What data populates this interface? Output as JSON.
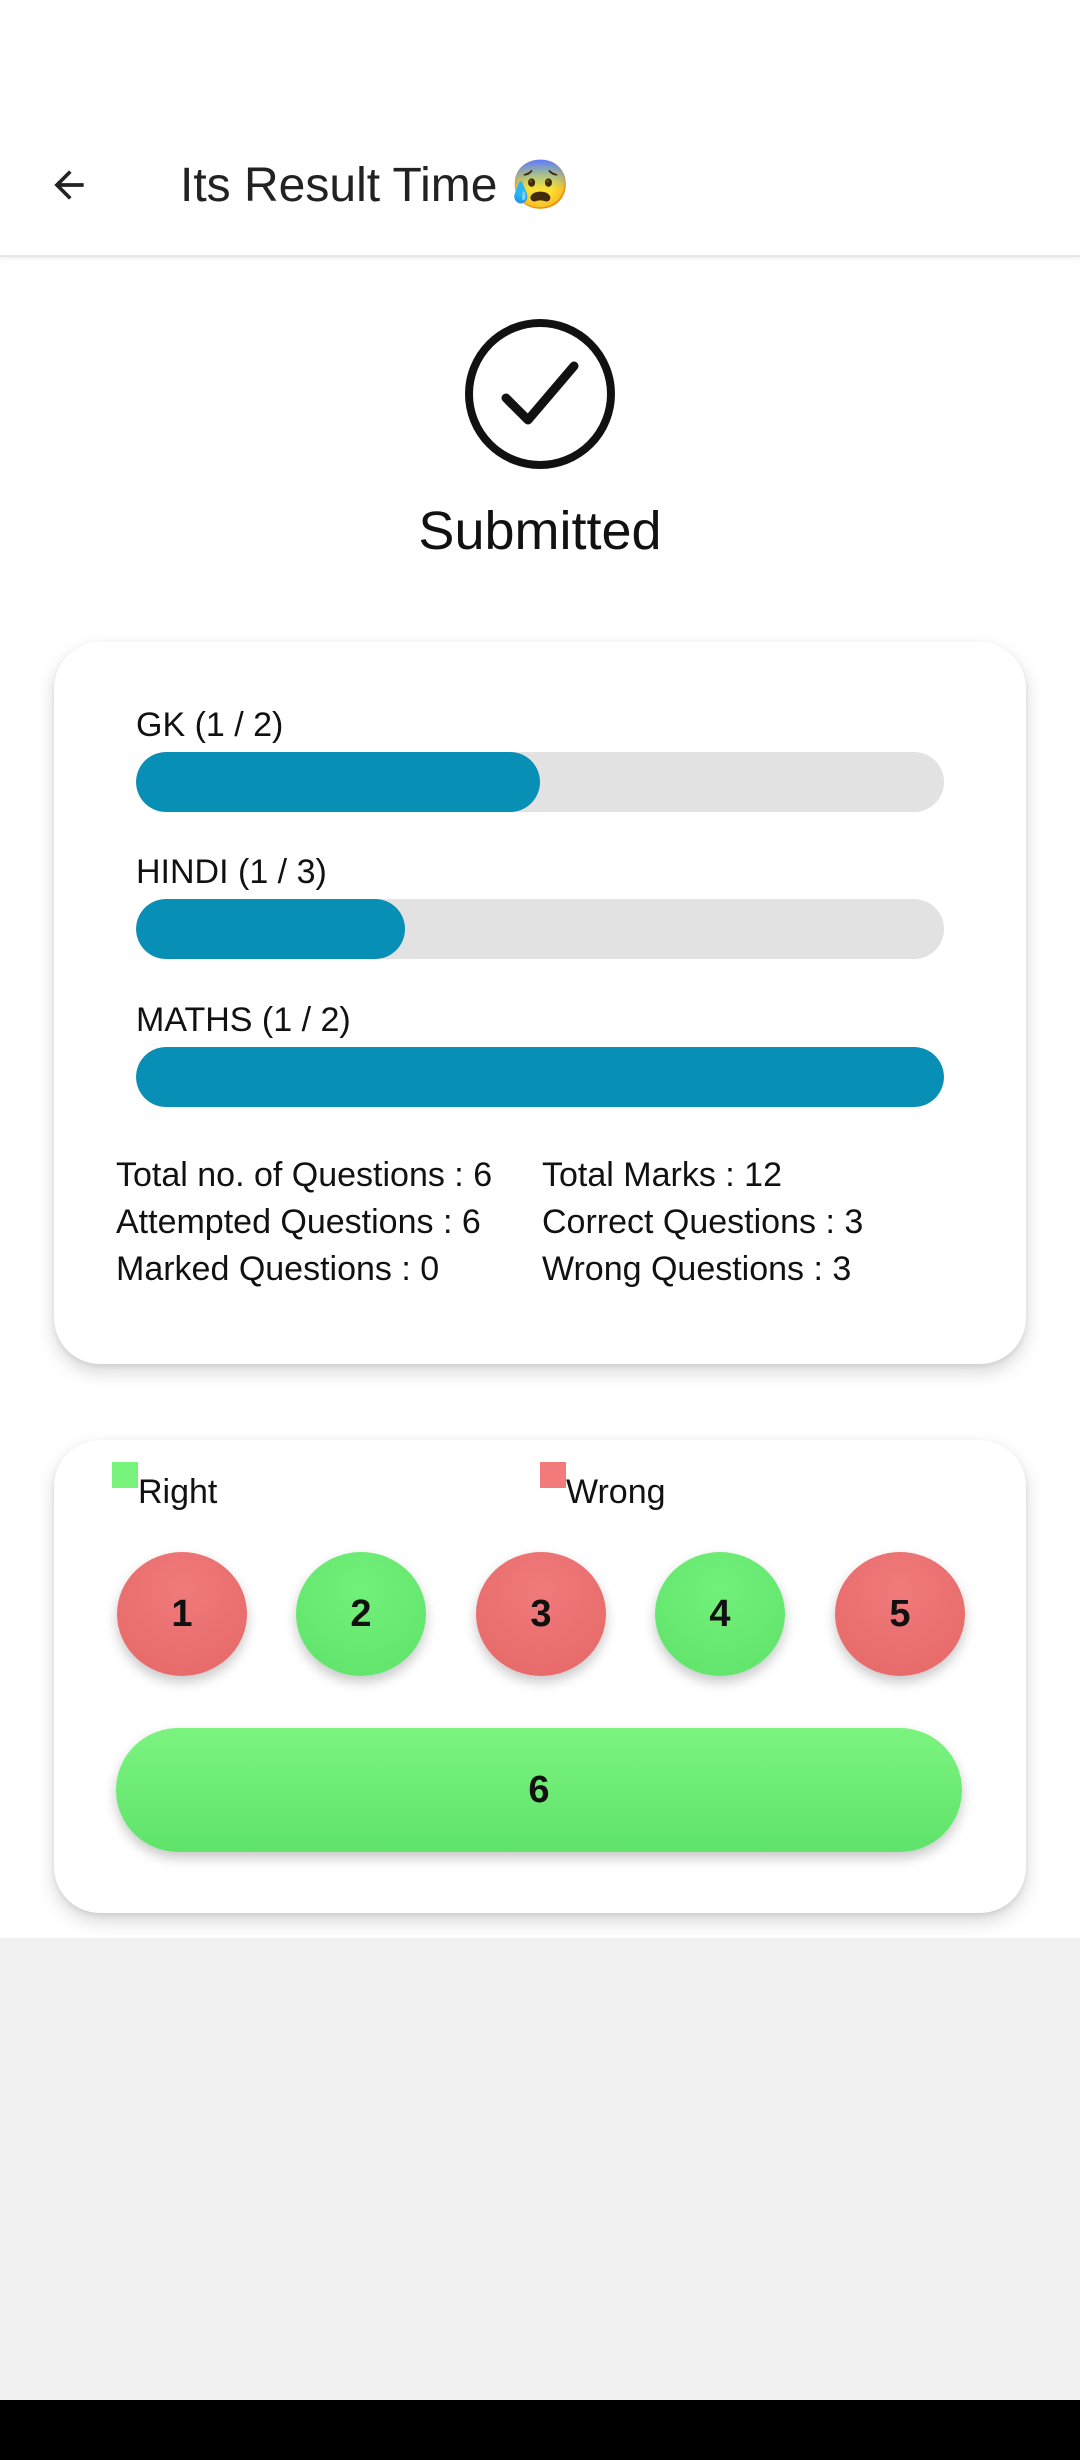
{
  "appbar": {
    "title": "Its Result Time 😰"
  },
  "status": {
    "title": "Submitted"
  },
  "subjects": [
    {
      "label": "GK (1 / 2)",
      "progress": 0.5
    },
    {
      "label": "HINDI (1 / 3)",
      "progress": 0.3333
    },
    {
      "label": "MATHS (1 / 2)",
      "progress": 1.0
    }
  ],
  "stats": {
    "total_questions": "Total no. of Questions : 6",
    "total_marks": "Total Marks : 12",
    "attempted": "Attempted Questions : 6",
    "correct": "Correct Questions : 3",
    "marked": "Marked Questions : 0",
    "wrong": "Wrong Questions : 3"
  },
  "legend": {
    "right_label": "Right",
    "wrong_label": "Wrong",
    "right_color": "#77f27a",
    "wrong_color": "#f27a7a"
  },
  "questions": [
    {
      "number": "1",
      "result": "wrong"
    },
    {
      "number": "2",
      "result": "right"
    },
    {
      "number": "3",
      "result": "wrong"
    },
    {
      "number": "4",
      "result": "right"
    },
    {
      "number": "5",
      "result": "wrong"
    },
    {
      "number": "6",
      "result": "right"
    }
  ],
  "colors": {
    "progress_fill": "#088fb5",
    "progress_track": "#e2e2e2"
  },
  "icons": {
    "back": "arrow-left-icon",
    "submitted": "check-circle-icon"
  }
}
